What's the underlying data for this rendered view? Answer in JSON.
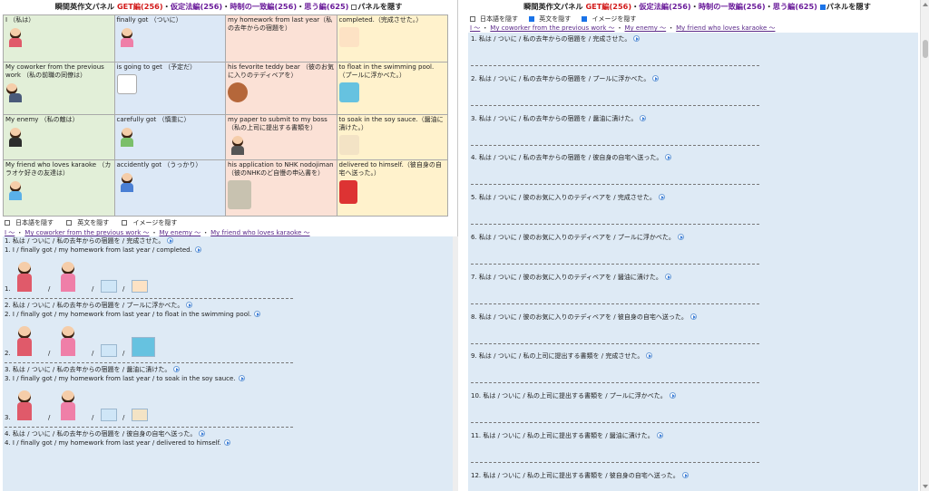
{
  "left": {
    "title": {
      "prefix": "瞬間英作文パネル",
      "get": "GET編(256)",
      "dot": "・",
      "kasetei": "仮定法編(256)",
      "jisei": "時制の一致編(256)",
      "omou": "思う編(625)",
      "hide_panel": "パネルを隠す"
    },
    "grid": [
      [
        "I （私は）",
        "finally got （ついに）",
        "my homework from last year（私の去年からの宿題を）",
        "completed.（完成させた。）"
      ],
      [
        "My coworker from the previous work （私の前職の同僚は）",
        "is going to get （予定だ）",
        "his fevorite teddy bear （彼のお気に入りのテディベアを）",
        "to float in the swimming pool.（プールに浮かべた。）"
      ],
      [
        "My enemy （私の敵は）",
        "carefully got （慎重に）",
        "my paper to submit to my boss（私の上司に提出する書類を）",
        "to soak in the soy sauce.（醤油に漬けた。）"
      ],
      [
        "My friend who loves karaoke （カラオケ好きの友達は）",
        "accidently got （うっかり）",
        "his application to NHK nodojiman（彼のNHKのど自慢の申込書を）",
        "delivered to himself.（彼自身の自宅へ送った。）"
      ]
    ],
    "options": [
      "日本語を隠す",
      "英文を隠す",
      "イメージを隠す"
    ],
    "nav": [
      "I 〜",
      "My coworker from the previous work 〜",
      "My enemy 〜",
      "My friend who loves karaoke 〜"
    ],
    "sep": "・",
    "exercises": [
      {
        "jp": "1. 私は / ついに / 私の去年からの宿題を / 完成させた。",
        "en": "1. I / finally got / my homework from last year / completed.",
        "num": "1."
      },
      {
        "jp": "2. 私は / ついに / 私の去年からの宿題を / プールに浮かべた。",
        "en": "2. I / finally got / my homework from last year / to float in the swimming pool.",
        "num": "2."
      },
      {
        "jp": "3. 私は / ついに / 私の去年からの宿題を / 醤油に漬けた。",
        "en": "3. I / finally got / my homework from last year / to soak in the soy sauce.",
        "num": "3."
      },
      {
        "jp": "4. 私は / ついに / 私の去年からの宿題を / 彼自身の自宅へ送った。",
        "en": "4. I / finally got / my homework from last year / delivered to himself.",
        "num": "4."
      }
    ],
    "slash": "/"
  },
  "right": {
    "title": {
      "prefix": "瞬間英作文パネル",
      "get": "GET編(256)",
      "dot": "・",
      "kasetei": "仮定法編(256)",
      "jisei": "時制の一致編(256)",
      "omou": "思う編(625)",
      "hide_panel": "パネルを隠す"
    },
    "options": [
      "日本語を隠す",
      "英文を隠す",
      "イメージを隠す"
    ],
    "options_checked": [
      false,
      true,
      true
    ],
    "nav": [
      "I 〜",
      "My coworker from the previous work 〜",
      "My enemy 〜",
      "My friend who loves karaoke 〜"
    ],
    "sep": "・",
    "sentences": [
      "1. 私は / ついに / 私の去年からの宿題を / 完成させた。",
      "2. 私は / ついに / 私の去年からの宿題を / プールに浮かべた。",
      "3. 私は / ついに / 私の去年からの宿題を / 醤油に漬けた。",
      "4. 私は / ついに / 私の去年からの宿題を / 彼自身の自宅へ送った。",
      "5. 私は / ついに / 彼のお気に入りのテディベアを / 完成させた。",
      "6. 私は / ついに / 彼のお気に入りのテディベアを / プールに浮かべた。",
      "7. 私は / ついに / 彼のお気に入りのテディベアを / 醤油に漬けた。",
      "8. 私は / ついに / 彼のお気に入りのテディベアを / 彼自身の自宅へ送った。",
      "9. 私は / ついに / 私の上司に提出する書類を / 完成させた。",
      "10. 私は / ついに / 私の上司に提出する書類を / プールに浮かべた。",
      "11. 私は / ついに / 私の上司に提出する書類を / 醤油に漬けた。",
      "12. 私は / ついに / 私の上司に提出する書類を / 彼自身の自宅へ送った。"
    ]
  },
  "colors": {
    "get": "#d21a1a",
    "link": "#6a1b9a",
    "green": "#e2efd8",
    "blue": "#dce8f6",
    "peach": "#fbe1d6",
    "yellow": "#fff2cc",
    "panel_bg": "#deeaf5"
  }
}
